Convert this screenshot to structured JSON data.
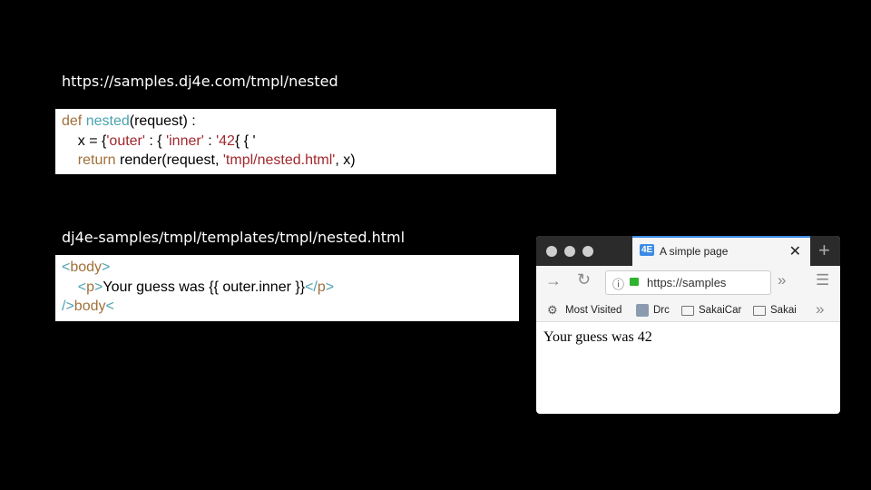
{
  "view_url_label": "https://samples.dj4e.com/tmpl/nested",
  "view_code": {
    "line1": {
      "kw": "def",
      "fn": "nested",
      "rest": "(request) :"
    },
    "line2": {
      "a": "x = {",
      "s1": "'outer'",
      "b": " : { ",
      "s2": "'inner'",
      "c": " : ",
      "s3": "'42",
      "d": "{ { '"
    },
    "line3": {
      "kw": "return",
      "a": " render(request, ",
      "s": "'tmpl/nested.html'",
      "b": ", x)"
    }
  },
  "template_path_label": "dj4e-samples/tmpl/templates/tmpl/nested.html",
  "template_code": {
    "line1": {
      "lt": "<",
      "tag": "body",
      "gt": ">"
    },
    "line2": {
      "lt": "<",
      "tag": "p",
      "gt": ">",
      "text": "Your guess was {{ outer.inner }}",
      "lt2": "</",
      "tag2": "p",
      "gt2": ">"
    },
    "line3": {
      "a": "/>",
      "tag": "body",
      "b": "<"
    }
  },
  "browser": {
    "tab_favicon": "4E",
    "tab_title": "A simple page",
    "url": "https://samples",
    "bookmarks": [
      "Most Visited",
      "Drc",
      "SakaiCar",
      "Sakai"
    ],
    "page_text": "Your guess was 42",
    "accent": "#3c8ce6"
  }
}
